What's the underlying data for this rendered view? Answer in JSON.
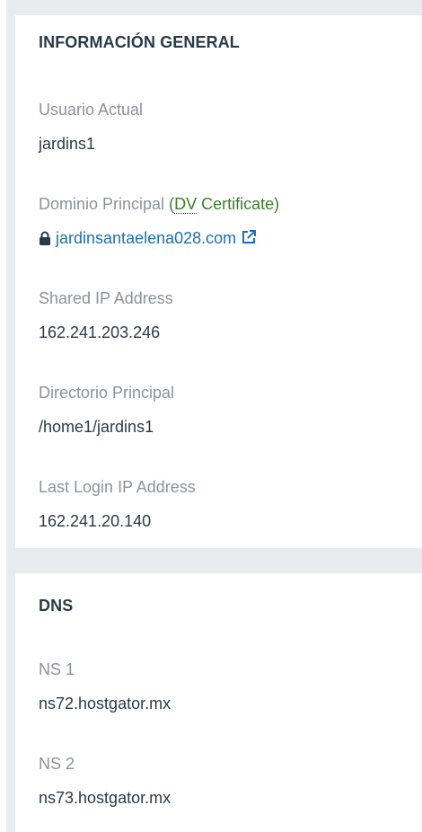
{
  "general": {
    "title": "INFORMACIÓN GENERAL",
    "current_user": {
      "label": "Usuario Actual",
      "value": "jardins1"
    },
    "primary_domain": {
      "label": "Dominio Principal",
      "cert_open": "(",
      "cert_abbr": "DV",
      "cert_rest": " Certificate)",
      "value": "jardinsantaelena028.com",
      "lock_icon": "lock-icon",
      "external_icon": "external-link-icon"
    },
    "shared_ip": {
      "label": "Shared IP Address",
      "value": "162.241.203.246"
    },
    "home_dir": {
      "label": "Directorio Principal",
      "value": "/home1/jardins1"
    },
    "last_login_ip": {
      "label": "Last Login IP Address",
      "value": "162.241.20.140"
    }
  },
  "dns": {
    "title": "DNS",
    "ns1": {
      "label": "NS 1",
      "value": "ns72.hostgator.mx"
    },
    "ns2": {
      "label": "NS 2",
      "value": "ns73.hostgator.mx"
    }
  },
  "colors": {
    "background": "#e9ecef",
    "panel": "#ffffff",
    "heading": "#293a4a",
    "label": "#8a939c",
    "link": "#1f6fb5",
    "certificate": "#3a7d2c"
  }
}
